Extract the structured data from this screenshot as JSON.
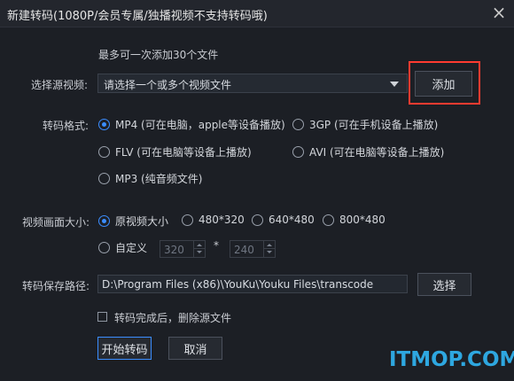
{
  "window": {
    "title": "新建转码(1080P/会员专属/独播视频不支持转码哦)",
    "close_glyph": "×"
  },
  "source": {
    "hint": "最多可一次添加30个文件",
    "label": "选择源视频:",
    "placeholder": "请选择一个或多个视频文件",
    "add_button": "添加"
  },
  "format": {
    "label": "转码格式:",
    "options": [
      {
        "label": "MP4 (可在电脑，apple等设备播放)",
        "checked": true
      },
      {
        "label": "3GP  (可在手机设备上播放)",
        "checked": false
      },
      {
        "label": "FLV  (可在电脑等设备上播放)",
        "checked": false
      },
      {
        "label": "AVI  (可在电脑等设备上播放)",
        "checked": false
      },
      {
        "label": "MP3 (纯音频文件)",
        "checked": false
      }
    ]
  },
  "size": {
    "label": "视频画面大小:",
    "options": [
      {
        "label": "原视频大小",
        "checked": true
      },
      {
        "label": "480*320",
        "checked": false
      },
      {
        "label": "640*480",
        "checked": false
      },
      {
        "label": "800*480",
        "checked": false
      },
      {
        "label": "自定义",
        "checked": false
      }
    ],
    "custom_width": "320",
    "custom_height": "240",
    "separator": "*"
  },
  "output": {
    "label": "转码保存路径:",
    "path": "D:\\Program Files (x86)\\YouKu\\Youku Files\\transcode",
    "browse_button": "选择"
  },
  "delete_after": {
    "label": "转码完成后，删除源文件",
    "checked": false
  },
  "actions": {
    "start": "开始转码",
    "cancel": "取消"
  },
  "watermark": "ITMOP.COM",
  "colors": {
    "accent": "#3b8dff",
    "highlight": "#ff3b30",
    "watermark": "#2ea7e0"
  }
}
